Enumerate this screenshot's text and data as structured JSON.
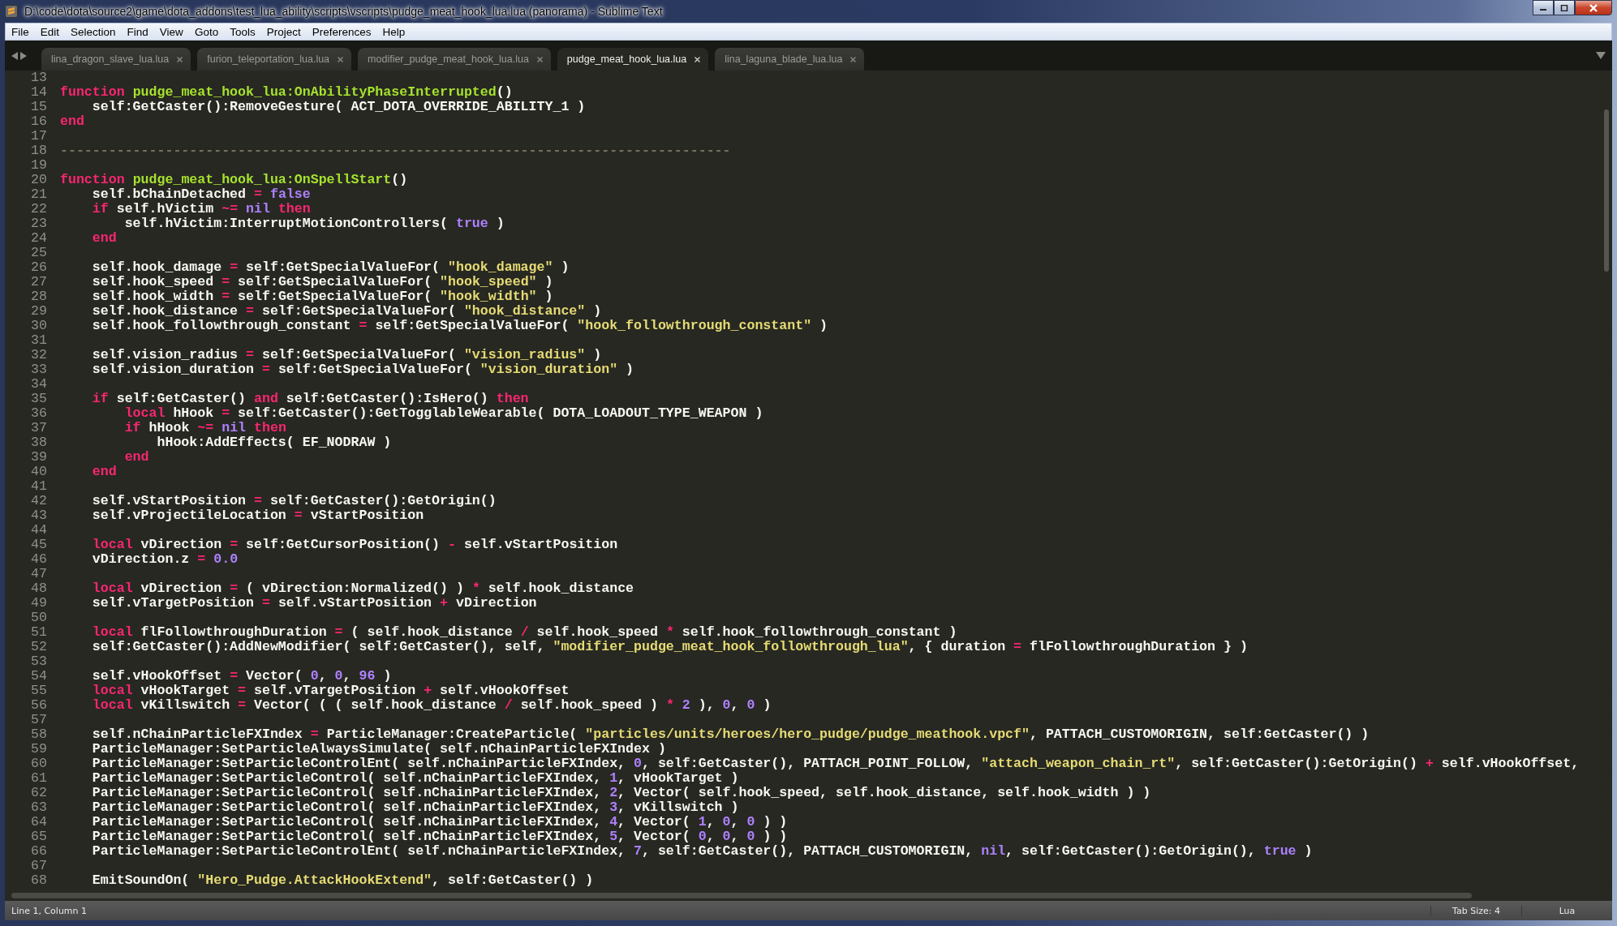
{
  "window": {
    "title": "D:\\code\\dota\\source2\\game\\dota_addons\\test_lua_ability\\scripts\\vscripts\\pudge_meat_hook_lua.lua (panorama) - Sublime Text"
  },
  "menu": [
    "File",
    "Edit",
    "Selection",
    "Find",
    "View",
    "Goto",
    "Tools",
    "Project",
    "Preferences",
    "Help"
  ],
  "tabs": [
    {
      "label": "lina_dragon_slave_lua.lua",
      "selected": false
    },
    {
      "label": "furion_teleportation_lua.lua",
      "selected": false
    },
    {
      "label": "modifier_pudge_meat_hook_lua.lua",
      "selected": false
    },
    {
      "label": "pudge_meat_hook_lua.lua",
      "selected": true
    },
    {
      "label": "lina_laguna_blade_lua.lua",
      "selected": false
    }
  ],
  "editor": {
    "lines": [
      {
        "number": "13"
      },
      {
        "number": "14",
        "tokens": [
          {
            "kind": "keyword",
            "text": "function"
          },
          {
            "kind": "function",
            "text": " pudge_meat_hook_lua:OnAbilityPhaseInterrupted"
          },
          {
            "kind": "plain",
            "text": "()"
          }
        ]
      },
      {
        "number": "15",
        "tokens": [
          {
            "kind": "plain",
            "text": "    self:GetCaster():RemoveGesture( ACT_DOTA_OVERRIDE_ABILITY_1 )"
          }
        ]
      },
      {
        "number": "16",
        "tokens": [
          {
            "kind": "keyword",
            "text": "end"
          }
        ]
      },
      {
        "number": "17"
      },
      {
        "number": "18",
        "tokens": [
          {
            "kind": "comment",
            "text": "-----------------------------------------------------------------------------------"
          }
        ]
      },
      {
        "number": "19"
      },
      {
        "number": "20",
        "tokens": [
          {
            "kind": "keyword",
            "text": "function"
          },
          {
            "kind": "function",
            "text": " pudge_meat_hook_lua:OnSpellStart"
          },
          {
            "kind": "plain",
            "text": "()"
          }
        ]
      },
      {
        "number": "21",
        "tokens": [
          {
            "kind": "plain",
            "text": "    self.bChainDetached "
          },
          {
            "kind": "keyword",
            "text": "="
          },
          {
            "kind": "constant",
            "text": " false"
          }
        ]
      },
      {
        "number": "22",
        "tokens": [
          {
            "kind": "keyword",
            "text": "    if"
          },
          {
            "kind": "plain",
            "text": " self.hVictim "
          },
          {
            "kind": "keyword",
            "text": "~="
          },
          {
            "kind": "constant",
            "text": " nil"
          },
          {
            "kind": "keyword",
            "text": " then"
          }
        ]
      },
      {
        "number": "23",
        "tokens": [
          {
            "kind": "plain",
            "text": "        self.hVictim:InterruptMotionControllers( "
          },
          {
            "kind": "constant",
            "text": "true"
          },
          {
            "kind": "plain",
            "text": " )"
          }
        ]
      },
      {
        "number": "24",
        "tokens": [
          {
            "kind": "keyword",
            "text": "    end"
          }
        ]
      },
      {
        "number": "25"
      },
      {
        "number": "26",
        "tokens": [
          {
            "kind": "plain",
            "text": "    self.hook_damage "
          },
          {
            "kind": "keyword",
            "text": "="
          },
          {
            "kind": "plain",
            "text": " self:GetSpecialValueFor( "
          },
          {
            "kind": "string",
            "text": "\"hook_damage\""
          },
          {
            "kind": "plain",
            "text": " )"
          }
        ]
      },
      {
        "number": "27",
        "tokens": [
          {
            "kind": "plain",
            "text": "    self.hook_speed "
          },
          {
            "kind": "keyword",
            "text": "="
          },
          {
            "kind": "plain",
            "text": " self:GetSpecialValueFor( "
          },
          {
            "kind": "string",
            "text": "\"hook_speed\""
          },
          {
            "kind": "plain",
            "text": " )"
          }
        ]
      },
      {
        "number": "28",
        "tokens": [
          {
            "kind": "plain",
            "text": "    self.hook_width "
          },
          {
            "kind": "keyword",
            "text": "="
          },
          {
            "kind": "plain",
            "text": " self:GetSpecialValueFor( "
          },
          {
            "kind": "string",
            "text": "\"hook_width\""
          },
          {
            "kind": "plain",
            "text": " )"
          }
        ]
      },
      {
        "number": "29",
        "tokens": [
          {
            "kind": "plain",
            "text": "    self.hook_distance "
          },
          {
            "kind": "keyword",
            "text": "="
          },
          {
            "kind": "plain",
            "text": " self:GetSpecialValueFor( "
          },
          {
            "kind": "string",
            "text": "\"hook_distance\""
          },
          {
            "kind": "plain",
            "text": " )"
          }
        ]
      },
      {
        "number": "30",
        "tokens": [
          {
            "kind": "plain",
            "text": "    self.hook_followthrough_constant "
          },
          {
            "kind": "keyword",
            "text": "="
          },
          {
            "kind": "plain",
            "text": " self:GetSpecialValueFor( "
          },
          {
            "kind": "string",
            "text": "\"hook_followthrough_constant\""
          },
          {
            "kind": "plain",
            "text": " )"
          }
        ]
      },
      {
        "number": "31"
      },
      {
        "number": "32",
        "tokens": [
          {
            "kind": "plain",
            "text": "    self.vision_radius "
          },
          {
            "kind": "keyword",
            "text": "="
          },
          {
            "kind": "plain",
            "text": " self:GetSpecialValueFor( "
          },
          {
            "kind": "string",
            "text": "\"vision_radius\""
          },
          {
            "kind": "plain",
            "text": " )"
          }
        ]
      },
      {
        "number": "33",
        "tokens": [
          {
            "kind": "plain",
            "text": "    self.vision_duration "
          },
          {
            "kind": "keyword",
            "text": "="
          },
          {
            "kind": "plain",
            "text": " self:GetSpecialValueFor( "
          },
          {
            "kind": "string",
            "text": "\"vision_duration\""
          },
          {
            "kind": "plain",
            "text": " )"
          }
        ]
      },
      {
        "number": "34"
      },
      {
        "number": "35",
        "tokens": [
          {
            "kind": "keyword",
            "text": "    if"
          },
          {
            "kind": "plain",
            "text": " self:GetCaster() "
          },
          {
            "kind": "keyword",
            "text": "and"
          },
          {
            "kind": "plain",
            "text": " self:GetCaster():IsHero() "
          },
          {
            "kind": "keyword",
            "text": "then"
          }
        ]
      },
      {
        "number": "36",
        "tokens": [
          {
            "kind": "keyword",
            "text": "        local"
          },
          {
            "kind": "plain",
            "text": " hHook "
          },
          {
            "kind": "keyword",
            "text": "="
          },
          {
            "kind": "plain",
            "text": " self:GetCaster():GetTogglableWearable( DOTA_LOADOUT_TYPE_WEAPON )"
          }
        ]
      },
      {
        "number": "37",
        "tokens": [
          {
            "kind": "keyword",
            "text": "        if"
          },
          {
            "kind": "plain",
            "text": " hHook "
          },
          {
            "kind": "keyword",
            "text": "~="
          },
          {
            "kind": "constant",
            "text": " nil"
          },
          {
            "kind": "keyword",
            "text": " then"
          }
        ]
      },
      {
        "number": "38",
        "tokens": [
          {
            "kind": "plain",
            "text": "            hHook:AddEffects( EF_NODRAW )"
          }
        ]
      },
      {
        "number": "39",
        "tokens": [
          {
            "kind": "keyword",
            "text": "        end"
          }
        ]
      },
      {
        "number": "40",
        "tokens": [
          {
            "kind": "keyword",
            "text": "    end"
          }
        ]
      },
      {
        "number": "41"
      },
      {
        "number": "42",
        "tokens": [
          {
            "kind": "plain",
            "text": "    self.vStartPosition "
          },
          {
            "kind": "keyword",
            "text": "="
          },
          {
            "kind": "plain",
            "text": " self:GetCaster():GetOrigin()"
          }
        ]
      },
      {
        "number": "43",
        "tokens": [
          {
            "kind": "plain",
            "text": "    self.vProjectileLocation "
          },
          {
            "kind": "keyword",
            "text": "="
          },
          {
            "kind": "plain",
            "text": " vStartPosition"
          }
        ]
      },
      {
        "number": "44"
      },
      {
        "number": "45",
        "tokens": [
          {
            "kind": "keyword",
            "text": "    local"
          },
          {
            "kind": "plain",
            "text": " vDirection "
          },
          {
            "kind": "keyword",
            "text": "="
          },
          {
            "kind": "plain",
            "text": " self:GetCursorPosition() "
          },
          {
            "kind": "keyword",
            "text": "-"
          },
          {
            "kind": "plain",
            "text": " self.vStartPosition"
          }
        ]
      },
      {
        "number": "46",
        "tokens": [
          {
            "kind": "plain",
            "text": "    vDirection.z "
          },
          {
            "kind": "keyword",
            "text": "="
          },
          {
            "kind": "constant",
            "text": " 0.0"
          }
        ]
      },
      {
        "number": "47"
      },
      {
        "number": "48",
        "tokens": [
          {
            "kind": "keyword",
            "text": "    local"
          },
          {
            "kind": "plain",
            "text": " vDirection "
          },
          {
            "kind": "keyword",
            "text": "="
          },
          {
            "kind": "plain",
            "text": " ( vDirection:Normalized() ) "
          },
          {
            "kind": "keyword",
            "text": "*"
          },
          {
            "kind": "plain",
            "text": " self.hook_distance"
          }
        ]
      },
      {
        "number": "49",
        "tokens": [
          {
            "kind": "plain",
            "text": "    self.vTargetPosition "
          },
          {
            "kind": "keyword",
            "text": "="
          },
          {
            "kind": "plain",
            "text": " self.vStartPosition "
          },
          {
            "kind": "keyword",
            "text": "+"
          },
          {
            "kind": "plain",
            "text": " vDirection"
          }
        ]
      },
      {
        "number": "50"
      },
      {
        "number": "51",
        "tokens": [
          {
            "kind": "keyword",
            "text": "    local"
          },
          {
            "kind": "plain",
            "text": " flFollowthroughDuration "
          },
          {
            "kind": "keyword",
            "text": "="
          },
          {
            "kind": "plain",
            "text": " ( self.hook_distance "
          },
          {
            "kind": "keyword",
            "text": "/"
          },
          {
            "kind": "plain",
            "text": " self.hook_speed "
          },
          {
            "kind": "keyword",
            "text": "*"
          },
          {
            "kind": "plain",
            "text": " self.hook_followthrough_constant )"
          }
        ]
      },
      {
        "number": "52",
        "tokens": [
          {
            "kind": "plain",
            "text": "    self:GetCaster():AddNewModifier( self:GetCaster(), self, "
          },
          {
            "kind": "string",
            "text": "\"modifier_pudge_meat_hook_followthrough_lua\""
          },
          {
            "kind": "plain",
            "text": ", { duration "
          },
          {
            "kind": "keyword",
            "text": "="
          },
          {
            "kind": "plain",
            "text": " flFollowthroughDuration } )"
          }
        ]
      },
      {
        "number": "53"
      },
      {
        "number": "54",
        "tokens": [
          {
            "kind": "plain",
            "text": "    self.vHookOffset "
          },
          {
            "kind": "keyword",
            "text": "="
          },
          {
            "kind": "plain",
            "text": " Vector( "
          },
          {
            "kind": "constant",
            "text": "0"
          },
          {
            "kind": "plain",
            "text": ", "
          },
          {
            "kind": "constant",
            "text": "0"
          },
          {
            "kind": "plain",
            "text": ", "
          },
          {
            "kind": "constant",
            "text": "96"
          },
          {
            "kind": "plain",
            "text": " )"
          }
        ]
      },
      {
        "number": "55",
        "tokens": [
          {
            "kind": "keyword",
            "text": "    local"
          },
          {
            "kind": "plain",
            "text": " vHookTarget "
          },
          {
            "kind": "keyword",
            "text": "="
          },
          {
            "kind": "plain",
            "text": " self.vTargetPosition "
          },
          {
            "kind": "keyword",
            "text": "+"
          },
          {
            "kind": "plain",
            "text": " self.vHookOffset"
          }
        ]
      },
      {
        "number": "56",
        "tokens": [
          {
            "kind": "keyword",
            "text": "    local"
          },
          {
            "kind": "plain",
            "text": " vKillswitch "
          },
          {
            "kind": "keyword",
            "text": "="
          },
          {
            "kind": "plain",
            "text": " Vector( ( ( self.hook_distance "
          },
          {
            "kind": "keyword",
            "text": "/"
          },
          {
            "kind": "plain",
            "text": " self.hook_speed ) "
          },
          {
            "kind": "keyword",
            "text": "*"
          },
          {
            "kind": "constant",
            "text": " 2"
          },
          {
            "kind": "plain",
            "text": " ), "
          },
          {
            "kind": "constant",
            "text": "0"
          },
          {
            "kind": "plain",
            "text": ", "
          },
          {
            "kind": "constant",
            "text": "0"
          },
          {
            "kind": "plain",
            "text": " )"
          }
        ]
      },
      {
        "number": "57"
      },
      {
        "number": "58",
        "tokens": [
          {
            "kind": "plain",
            "text": "    self.nChainParticleFXIndex "
          },
          {
            "kind": "keyword",
            "text": "="
          },
          {
            "kind": "plain",
            "text": " ParticleManager:CreateParticle( "
          },
          {
            "kind": "string",
            "text": "\"particles/units/heroes/hero_pudge/pudge_meathook.vpcf\""
          },
          {
            "kind": "plain",
            "text": ", PATTACH_CUSTOMORIGIN, self:GetCaster() )"
          }
        ]
      },
      {
        "number": "59",
        "tokens": [
          {
            "kind": "plain",
            "text": "    ParticleManager:SetParticleAlwaysSimulate( self.nChainParticleFXIndex )"
          }
        ]
      },
      {
        "number": "60",
        "tokens": [
          {
            "kind": "plain",
            "text": "    ParticleManager:SetParticleControlEnt( self.nChainParticleFXIndex, "
          },
          {
            "kind": "constant",
            "text": "0"
          },
          {
            "kind": "plain",
            "text": ", self:GetCaster(), PATTACH_POINT_FOLLOW, "
          },
          {
            "kind": "string",
            "text": "\"attach_weapon_chain_rt\""
          },
          {
            "kind": "plain",
            "text": ", self:GetCaster():GetOrigin() "
          },
          {
            "kind": "keyword",
            "text": "+"
          },
          {
            "kind": "plain",
            "text": " self.vHookOffset,"
          }
        ]
      },
      {
        "number": "61",
        "tokens": [
          {
            "kind": "plain",
            "text": "    ParticleManager:SetParticleControl( self.nChainParticleFXIndex, "
          },
          {
            "kind": "constant",
            "text": "1"
          },
          {
            "kind": "plain",
            "text": ", vHookTarget )"
          }
        ]
      },
      {
        "number": "62",
        "tokens": [
          {
            "kind": "plain",
            "text": "    ParticleManager:SetParticleControl( self.nChainParticleFXIndex, "
          },
          {
            "kind": "constant",
            "text": "2"
          },
          {
            "kind": "plain",
            "text": ", Vector( self.hook_speed, self.hook_distance, self.hook_width ) )"
          }
        ]
      },
      {
        "number": "63",
        "tokens": [
          {
            "kind": "plain",
            "text": "    ParticleManager:SetParticleControl( self.nChainParticleFXIndex, "
          },
          {
            "kind": "constant",
            "text": "3"
          },
          {
            "kind": "plain",
            "text": ", vKillswitch )"
          }
        ]
      },
      {
        "number": "64",
        "tokens": [
          {
            "kind": "plain",
            "text": "    ParticleManager:SetParticleControl( self.nChainParticleFXIndex, "
          },
          {
            "kind": "constant",
            "text": "4"
          },
          {
            "kind": "plain",
            "text": ", Vector( "
          },
          {
            "kind": "constant",
            "text": "1"
          },
          {
            "kind": "plain",
            "text": ", "
          },
          {
            "kind": "constant",
            "text": "0"
          },
          {
            "kind": "plain",
            "text": ", "
          },
          {
            "kind": "constant",
            "text": "0"
          },
          {
            "kind": "plain",
            "text": " ) )"
          }
        ]
      },
      {
        "number": "65",
        "tokens": [
          {
            "kind": "plain",
            "text": "    ParticleManager:SetParticleControl( self.nChainParticleFXIndex, "
          },
          {
            "kind": "constant",
            "text": "5"
          },
          {
            "kind": "plain",
            "text": ", Vector( "
          },
          {
            "kind": "constant",
            "text": "0"
          },
          {
            "kind": "plain",
            "text": ", "
          },
          {
            "kind": "constant",
            "text": "0"
          },
          {
            "kind": "plain",
            "text": ", "
          },
          {
            "kind": "constant",
            "text": "0"
          },
          {
            "kind": "plain",
            "text": " ) )"
          }
        ]
      },
      {
        "number": "66",
        "tokens": [
          {
            "kind": "plain",
            "text": "    ParticleManager:SetParticleControlEnt( self.nChainParticleFXIndex, "
          },
          {
            "kind": "constant",
            "text": "7"
          },
          {
            "kind": "plain",
            "text": ", self:GetCaster(), PATTACH_CUSTOMORIGIN, "
          },
          {
            "kind": "constant",
            "text": "nil"
          },
          {
            "kind": "plain",
            "text": ", self:GetCaster():GetOrigin(), "
          },
          {
            "kind": "constant",
            "text": "true"
          },
          {
            "kind": "plain",
            "text": " )"
          }
        ]
      },
      {
        "number": "67"
      },
      {
        "number": "68",
        "tokens": [
          {
            "kind": "plain",
            "text": "    EmitSoundOn( "
          },
          {
            "kind": "string",
            "text": "\"Hero_Pudge.AttackHookExtend\""
          },
          {
            "kind": "plain",
            "text": ", self:GetCaster() )"
          }
        ]
      }
    ]
  },
  "status_bar": {
    "position": "Line 1, Column 1",
    "tab_size": "Tab Size: 4",
    "syntax": "Lua"
  }
}
